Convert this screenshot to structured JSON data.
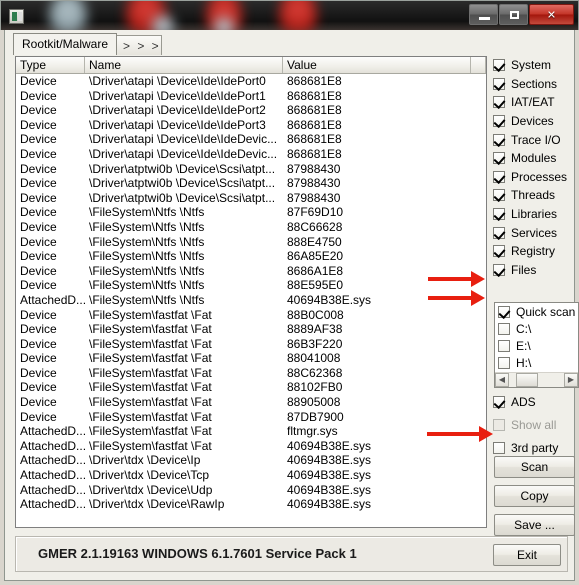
{
  "window": {
    "title": "",
    "icon": "app-icon",
    "controls": {
      "minimize": "–",
      "maximize": "☐",
      "close": "✕"
    }
  },
  "tabs": [
    {
      "label": "Rootkit/Malware",
      "active": true
    },
    {
      "label": "> > >",
      "active": false
    }
  ],
  "table": {
    "columns": [
      "Type",
      "Name",
      "Value"
    ],
    "rows": [
      [
        "Device",
        "\\Driver\\atapi \\Device\\Ide\\IdePort0",
        "868681E8"
      ],
      [
        "Device",
        "\\Driver\\atapi \\Device\\Ide\\IdePort1",
        "868681E8"
      ],
      [
        "Device",
        "\\Driver\\atapi \\Device\\Ide\\IdePort2",
        "868681E8"
      ],
      [
        "Device",
        "\\Driver\\atapi \\Device\\Ide\\IdePort3",
        "868681E8"
      ],
      [
        "Device",
        "\\Driver\\atapi \\Device\\Ide\\IdeDevic...",
        "868681E8"
      ],
      [
        "Device",
        "\\Driver\\atapi \\Device\\Ide\\IdeDevic...",
        "868681E8"
      ],
      [
        "Device",
        "\\Driver\\atptwi0b \\Device\\Scsi\\atpt...",
        "87988430"
      ],
      [
        "Device",
        "\\Driver\\atptwi0b \\Device\\Scsi\\atpt...",
        "87988430"
      ],
      [
        "Device",
        "\\Driver\\atptwi0b \\Device\\Scsi\\atpt...",
        "87988430"
      ],
      [
        "Device",
        "\\FileSystem\\Ntfs \\Ntfs",
        "87F69D10"
      ],
      [
        "Device",
        "\\FileSystem\\Ntfs \\Ntfs",
        "88C66628"
      ],
      [
        "Device",
        "\\FileSystem\\Ntfs \\Ntfs",
        "888E4750"
      ],
      [
        "Device",
        "\\FileSystem\\Ntfs \\Ntfs",
        "86A85E20"
      ],
      [
        "Device",
        "\\FileSystem\\Ntfs \\Ntfs",
        "8686A1E8"
      ],
      [
        "Device",
        "\\FileSystem\\Ntfs \\Ntfs",
        "88E595E0"
      ],
      [
        "AttachedD...",
        "\\FileSystem\\Ntfs \\Ntfs",
        "40694B38E.sys"
      ],
      [
        "Device",
        "\\FileSystem\\fastfat \\Fat",
        "88B0C008"
      ],
      [
        "Device",
        "\\FileSystem\\fastfat \\Fat",
        "8889AF38"
      ],
      [
        "Device",
        "\\FileSystem\\fastfat \\Fat",
        "86B3F220"
      ],
      [
        "Device",
        "\\FileSystem\\fastfat \\Fat",
        "88041008"
      ],
      [
        "Device",
        "\\FileSystem\\fastfat \\Fat",
        "88C62368"
      ],
      [
        "Device",
        "\\FileSystem\\fastfat \\Fat",
        "88102FB0"
      ],
      [
        "Device",
        "\\FileSystem\\fastfat \\Fat",
        "88905008"
      ],
      [
        "Device",
        "\\FileSystem\\fastfat \\Fat",
        "87DB7900"
      ],
      [
        "AttachedD...",
        "\\FileSystem\\fastfat \\Fat",
        "fltmgr.sys"
      ],
      [
        "AttachedD...",
        "\\FileSystem\\fastfat \\Fat",
        "40694B38E.sys"
      ],
      [
        "AttachedD...",
        "\\Driver\\tdx \\Device\\Ip",
        "40694B38E.sys"
      ],
      [
        "AttachedD...",
        "\\Driver\\tdx \\Device\\Tcp",
        "40694B38E.sys"
      ],
      [
        "AttachedD...",
        "\\Driver\\tdx \\Device\\Udp",
        "40694B38E.sys"
      ],
      [
        "AttachedD...",
        "\\Driver\\tdx \\Device\\RawIp",
        "40694B38E.sys"
      ]
    ]
  },
  "options": {
    "scan_targets": [
      {
        "label": "System",
        "checked": true,
        "enabled": true
      },
      {
        "label": "Sections",
        "checked": true,
        "enabled": true
      },
      {
        "label": "IAT/EAT",
        "checked": true,
        "enabled": true
      },
      {
        "label": "Devices",
        "checked": true,
        "enabled": true
      },
      {
        "label": "Trace I/O",
        "checked": true,
        "enabled": true
      },
      {
        "label": "Modules",
        "checked": true,
        "enabled": true
      },
      {
        "label": "Processes",
        "checked": true,
        "enabled": true
      },
      {
        "label": "Threads",
        "checked": true,
        "enabled": true
      },
      {
        "label": "Libraries",
        "checked": true,
        "enabled": true
      },
      {
        "label": "Services",
        "checked": true,
        "enabled": true
      },
      {
        "label": "Registry",
        "checked": true,
        "enabled": true
      },
      {
        "label": "Files",
        "checked": true,
        "enabled": true
      }
    ],
    "drives": [
      {
        "label": "Quick scan",
        "checked": true,
        "enabled": true
      },
      {
        "label": "C:\\",
        "checked": false,
        "enabled": true
      },
      {
        "label": "E:\\",
        "checked": false,
        "enabled": true
      },
      {
        "label": "H:\\",
        "checked": false,
        "enabled": true
      }
    ],
    "extras": [
      {
        "label": "ADS",
        "checked": true,
        "enabled": true
      },
      {
        "label": "Show all",
        "checked": false,
        "enabled": false
      },
      {
        "label": "3rd party",
        "checked": false,
        "enabled": true
      }
    ]
  },
  "buttons": {
    "scan": "Scan",
    "copy": "Copy",
    "save": "Save ...",
    "exit": "Exit"
  },
  "statusbar": {
    "text": "GMER 2.1.19163    WINDOWS 6.1.7601 Service Pack 1"
  },
  "annotations": {
    "arrow_color": "#e81f10",
    "arrows": [
      {
        "target": "Quick scan"
      },
      {
        "target": "C:\\"
      },
      {
        "target": "Scan"
      }
    ]
  },
  "colors": {
    "accent_red": "#e81f10",
    "window_bg": "#f0efe9",
    "close_button": "#c33528"
  }
}
